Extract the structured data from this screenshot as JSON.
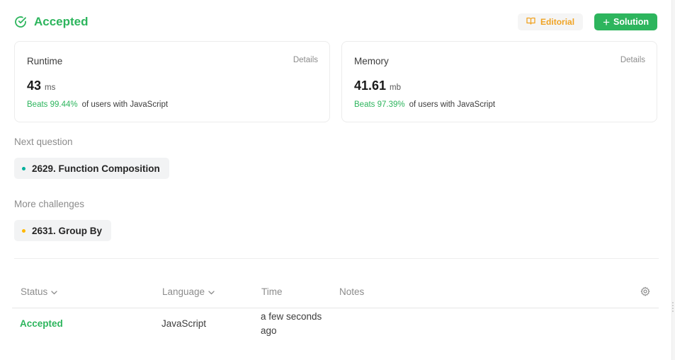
{
  "header": {
    "status": "Accepted",
    "status_icon": "check-circle-icon",
    "editorial_label": "Editorial",
    "editorial_icon": "book-icon",
    "solution_label": "Solution",
    "solution_icon": "plus-icon"
  },
  "runtime": {
    "title": "Runtime",
    "details": "Details",
    "value": "43",
    "unit": "ms",
    "beats_pct": "Beats 99.44%",
    "beats_text": "of users with JavaScript"
  },
  "memory": {
    "title": "Memory",
    "details": "Details",
    "value": "41.61",
    "unit": "mb",
    "beats_pct": "Beats 97.39%",
    "beats_text": "of users with JavaScript"
  },
  "next_question": {
    "label": "Next question",
    "item": "2629. Function Composition",
    "dot_color": "#00af9b"
  },
  "more_challenges": {
    "label": "More challenges",
    "item": "2631. Group By",
    "dot_color": "#ffb800"
  },
  "table": {
    "headers": {
      "status": "Status",
      "language": "Language",
      "time": "Time",
      "notes": "Notes"
    },
    "rows": [
      {
        "status": "Accepted",
        "language": "JavaScript",
        "time": "a few seconds ago",
        "notes": ""
      }
    ]
  },
  "colors": {
    "accent_green": "#2db55d",
    "editorial_orange": "#f0a323"
  }
}
